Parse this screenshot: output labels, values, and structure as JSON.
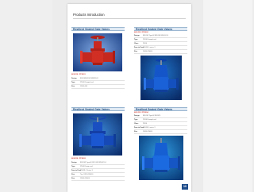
{
  "page_title": "Products Introduction",
  "page_number": "10",
  "products": [
    {
      "header": "Resilient Seated Gate Valves",
      "title": "AVK-RS / PF0001",
      "specs": [
        {
          "key": "Design",
          "value": "BS5163/EN1074/BS5163"
        },
        {
          "key": "Type",
          "value": "PN16 Flanged end"
        },
        {
          "key": "Size",
          "value": "DN50-600"
        }
      ]
    },
    {
      "header": "Resilient Seated Gate Valves",
      "title": "AVK-RS / PF0002",
      "specs": [
        {
          "key": "Design",
          "value": "BS5163 Type B/ BS5163/ EN1074-1"
        },
        {
          "key": "Type",
          "value": "PN16 Flanged end"
        },
        {
          "key": "Class",
          "value": "PN16"
        },
        {
          "key": "Face to Face",
          "value": "EN558-1 series 3"
        },
        {
          "key": "Size",
          "value": "DN50-DN600"
        }
      ]
    },
    {
      "header": "Resilient Seated Gate Valves",
      "title": "AVK-RS / PF0003",
      "specs": [
        {
          "key": "Design",
          "value": "BS5163 Type A / BS 5163 /EN1074-1"
        },
        {
          "key": "Type",
          "value": "PN16 Flange end"
        },
        {
          "key": "Face to Face",
          "value": "EN558-1 Series 3"
        },
        {
          "key": "Size",
          "value": "Top: DN50-DN600"
        },
        {
          "key": "Size",
          "value": "DN50-DN600"
        }
      ]
    },
    {
      "header": "Resilient Seated Gate Valves",
      "title": "AVK-RS / PF0004",
      "specs": [
        {
          "key": "Design",
          "value": "BS5163 Type B/ EN1074"
        },
        {
          "key": "Type",
          "value": "PN16 Flanged end"
        },
        {
          "key": "Class",
          "value": "PN16"
        },
        {
          "key": "Face to Face",
          "value": "EN558-1 series 3"
        },
        {
          "key": "Size",
          "value": "DN50-DN600"
        }
      ]
    }
  ]
}
